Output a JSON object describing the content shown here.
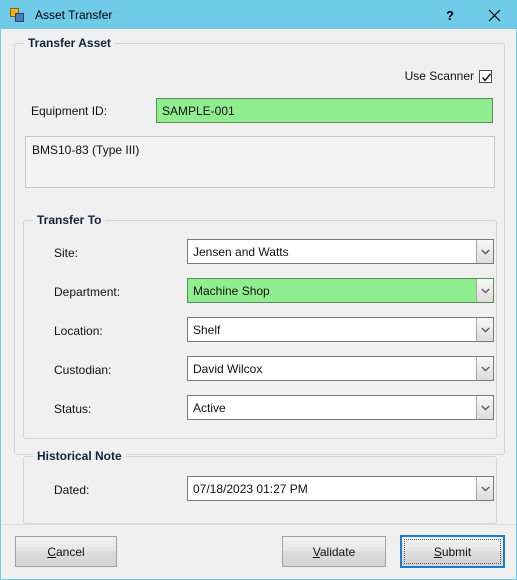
{
  "window": {
    "title": "Asset Transfer",
    "icon": "asset-transfer-icon",
    "titlebar_color": "#6fcbe8",
    "background_color": "#f0f0f0",
    "help_label": "?",
    "close_label": "✕"
  },
  "transfer_asset": {
    "group_title": "Transfer Asset",
    "use_scanner": {
      "label": "Use Scanner",
      "checked": true
    },
    "equipment_id": {
      "label": "Equipment ID:",
      "value": "SAMPLE-001",
      "highlight_color": "#90ee90"
    },
    "description": {
      "value": "BMS10-83 (Type III)"
    }
  },
  "transfer_to": {
    "group_title": "Transfer To",
    "fields": [
      {
        "label": "Site:",
        "value": "Jensen and Watts",
        "highlighted": false
      },
      {
        "label": "Department:",
        "value": "Machine Shop",
        "highlighted": true
      },
      {
        "label": "Location:",
        "value": "Shelf",
        "highlighted": false
      },
      {
        "label": "Custodian:",
        "value": "David Wilcox",
        "highlighted": false
      },
      {
        "label": "Status:",
        "value": "Active",
        "highlighted": false
      }
    ]
  },
  "historical_note": {
    "group_title": "Historical Note",
    "dated": {
      "label": "Dated:",
      "value": "07/18/2023 01:27 PM"
    }
  },
  "buttons": {
    "cancel": {
      "label": "Cancel",
      "accel": "C",
      "default": false
    },
    "validate": {
      "label": "Validate",
      "accel": "V",
      "default": false
    },
    "submit": {
      "label": "Submit",
      "accel": "S",
      "default": true
    }
  }
}
